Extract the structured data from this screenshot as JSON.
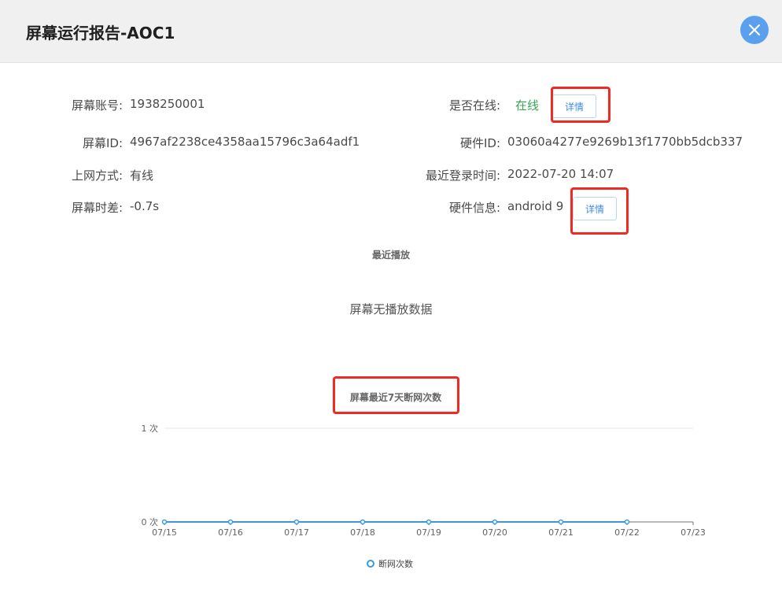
{
  "header": {
    "title": "屏幕运行报告-AOC1"
  },
  "info": {
    "account_label": "屏幕账号:",
    "account_value": "1938250001",
    "screen_id_label": "屏幕ID:",
    "screen_id_value": "4967af2238ce4358aa15796c3a64adf1",
    "net_label": "上网方式:",
    "net_value": "有线",
    "timediff_label": "屏幕时差:",
    "timediff_value": "-0.7s",
    "online_label": "是否在线:",
    "online_value": "在线",
    "hw_id_label": "硬件ID:",
    "hw_id_value": "03060a4277e9269b13f1770bb5dcb337",
    "last_login_label": "最近登录时间:",
    "last_login_value": "2022-07-20 14:07",
    "hw_info_label": "硬件信息:",
    "hw_info_value": "android 9",
    "detail_label": "详情"
  },
  "recent_play": {
    "title": "最近播放",
    "empty_text": "屏幕无播放数据"
  },
  "colors": {
    "online": "#36a852",
    "series": "#3a9ad9",
    "highlight": "#ee2a22",
    "close": "#5aa0ef"
  },
  "chart_data": {
    "type": "line",
    "title": "屏幕最近7天断网次数",
    "categories": [
      "07/15",
      "07/16",
      "07/17",
      "07/18",
      "07/19",
      "07/20",
      "07/21",
      "07/22",
      "07/23"
    ],
    "series": [
      {
        "name": "断网次数",
        "values": [
          0,
          0,
          0,
          0,
          0,
          0,
          0,
          0,
          null
        ]
      }
    ],
    "yticks": [
      "0 次",
      "1 次"
    ],
    "ylim": [
      0,
      1
    ],
    "legend": "bottom-center",
    "grid": true
  }
}
